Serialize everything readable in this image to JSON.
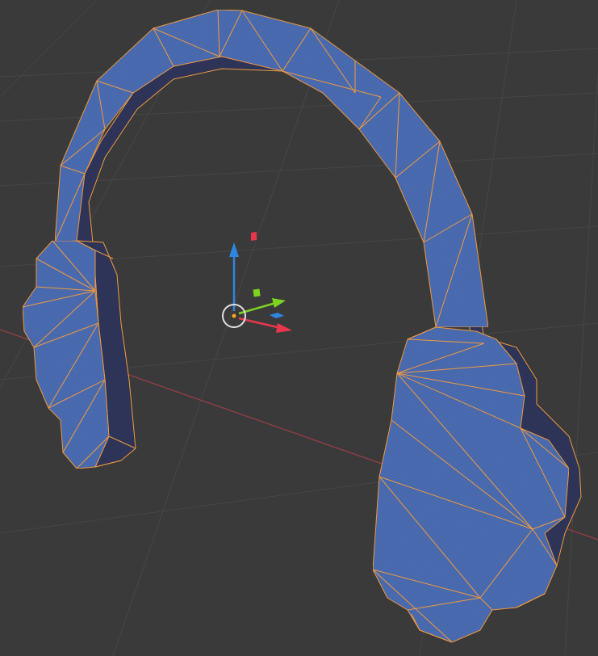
{
  "app": "3D viewport",
  "viewport": {
    "background": "#3a3a3a",
    "grid_color": "#4a4a4a",
    "x_axis_color": "#b84a55"
  },
  "object": {
    "name": "headphones",
    "mode": "edit-wireframe-overlay",
    "face_color": "#4a6bb0",
    "face_shadow_color": "#3a4f88",
    "inner_dark_color": "#2d3457",
    "edge_color": "#f09a3e"
  },
  "gizmo": {
    "type": "transform",
    "x_axis_color": "#e8374a",
    "y_axis_color": "#7ed321",
    "z_axis_color": "#2f86e0",
    "origin_color": "#f5a623",
    "cursor_icon": "3d-cursor-icon"
  }
}
